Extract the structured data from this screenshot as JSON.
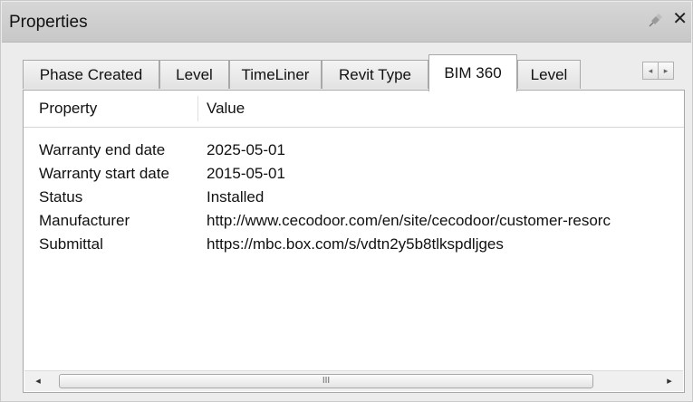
{
  "window": {
    "title": "Properties",
    "pin_icon": "pin-icon",
    "close_label": "✕"
  },
  "tabs": [
    {
      "label": "Phase Created"
    },
    {
      "label": "Level"
    },
    {
      "label": "TimeLiner"
    },
    {
      "label": "Revit Type"
    },
    {
      "label": "BIM 360",
      "active": true
    },
    {
      "label": "Level"
    }
  ],
  "tab_scroll": {
    "left": "◂",
    "right": "▸"
  },
  "table": {
    "columns": [
      "Property",
      "Value"
    ],
    "rows": [
      {
        "property": "Warranty end date",
        "value": "2025-05-01"
      },
      {
        "property": "Warranty start date",
        "value": "2015-05-01"
      },
      {
        "property": "Status",
        "value": "Installed"
      },
      {
        "property": "Manufacturer",
        "value": "http://www.cecodoor.com/en/site/cecodoor/customer-resorc"
      },
      {
        "property": "Submittal",
        "value": "https://mbc.box.com/s/vdtn2y5b8tlkspdljges"
      }
    ]
  },
  "scrollbar": {
    "left_arrow": "◂",
    "right_arrow": "▸",
    "grip": "III"
  }
}
